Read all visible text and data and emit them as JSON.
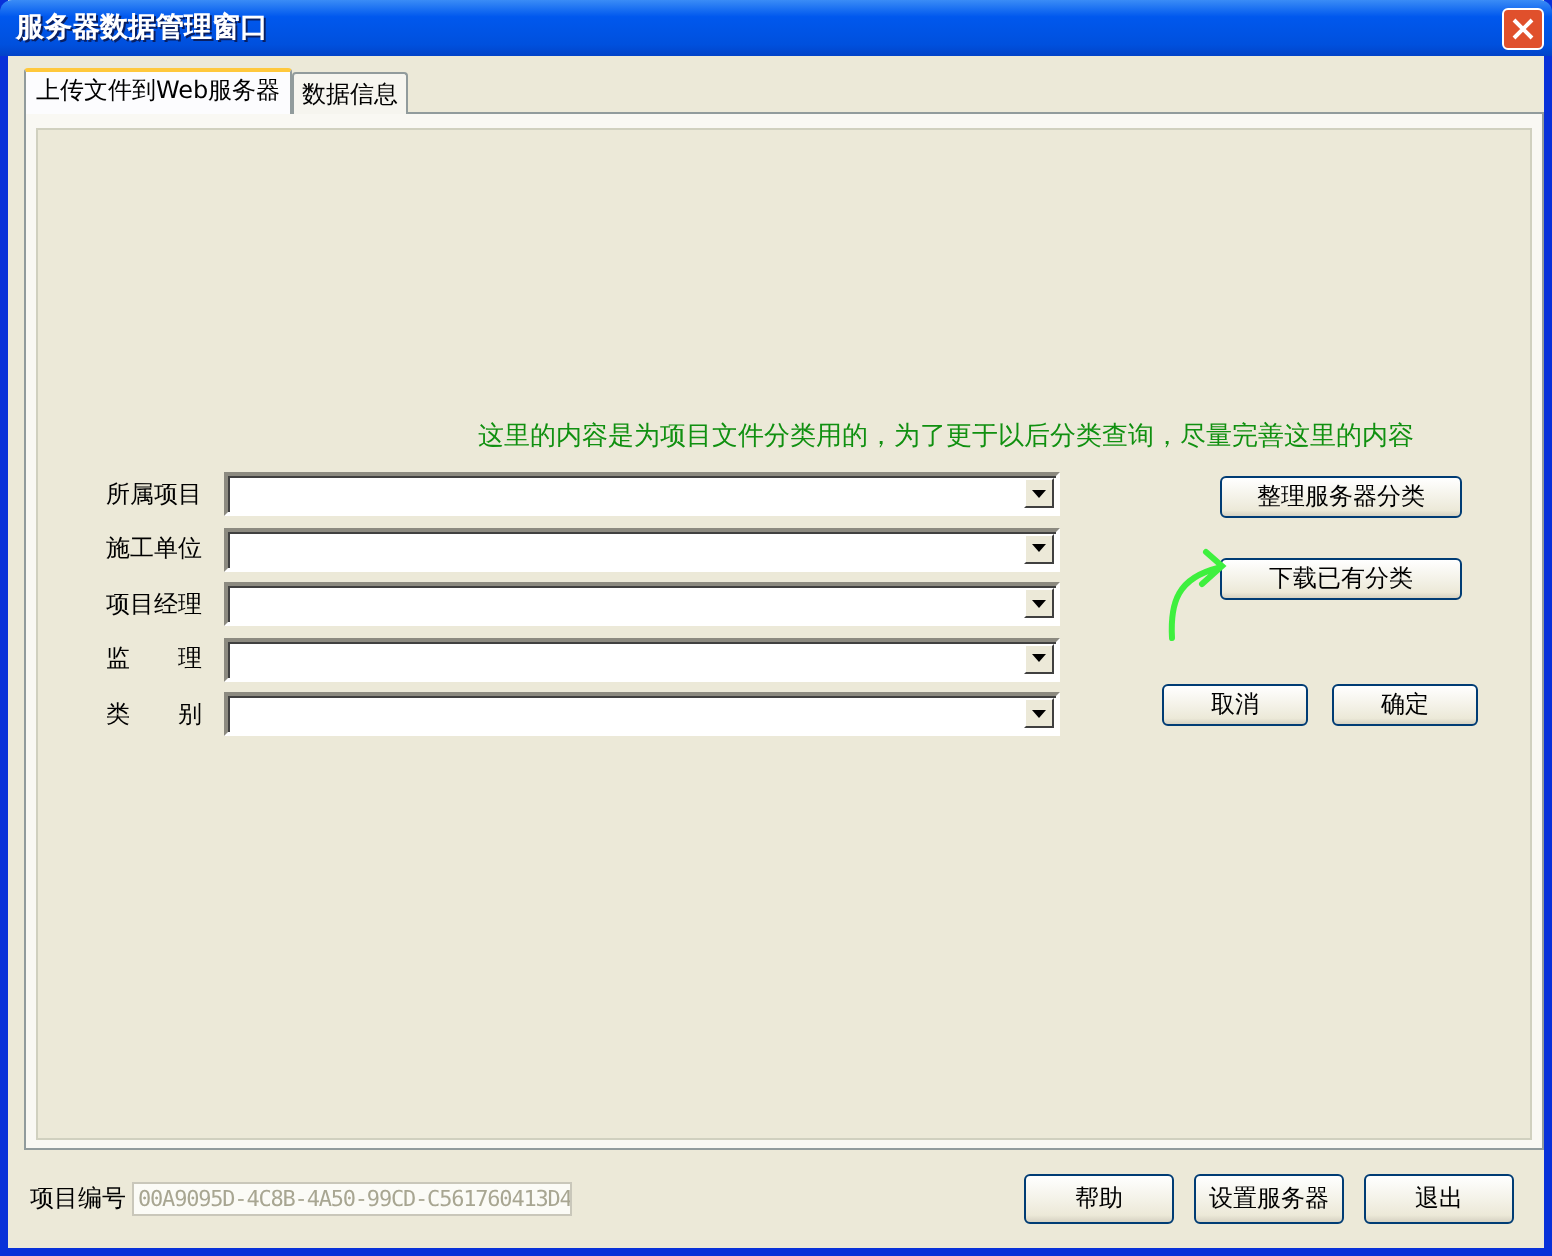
{
  "window": {
    "title": "服务器数据管理窗口"
  },
  "tabs": [
    {
      "label": "上传文件到Web服务器",
      "selected": true
    },
    {
      "label": "数据信息",
      "selected": false
    }
  ],
  "note": "这里的内容是为项目文件分类用的，为了更于以后分类查询，尽量完善这里的内容",
  "fields": [
    {
      "label": "所属项目"
    },
    {
      "label": "施工单位"
    },
    {
      "label": "项目经理"
    },
    {
      "label": "监 理"
    },
    {
      "label": "类 别"
    }
  ],
  "side_buttons": [
    "整理服务器分类",
    "下载已有分类"
  ],
  "action_buttons": [
    "取消",
    "确定"
  ],
  "project_id": {
    "label": "项目编号",
    "value": "00A9095D-4C8B-4A50-99CD-C561760413D4",
    "disabled": true
  },
  "footer_buttons": [
    "帮助",
    "设置服务器",
    "退出"
  ]
}
